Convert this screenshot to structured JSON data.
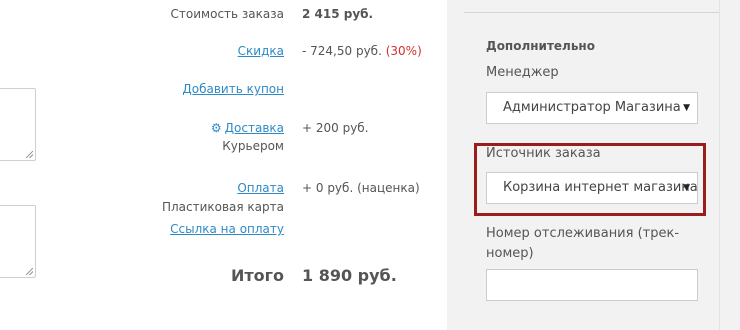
{
  "summary": {
    "order_cost": {
      "label": "Стоимость заказа",
      "value": "2 415 руб."
    },
    "discount": {
      "label": "Скидка",
      "value": "- 724,50 руб.",
      "percent": "(30%)"
    },
    "coupon_link": "Добавить купон",
    "delivery": {
      "label": "Доставка",
      "value": "+ 200 руб.",
      "method": "Курьером",
      "icon": "gear-icon"
    },
    "payment": {
      "label": "Оплата",
      "value": "+ 0 руб. (наценка)",
      "method": "Пластиковая карта",
      "link": "Ссылка на оплату"
    },
    "total": {
      "label": "Итого",
      "value": "1 890 руб."
    }
  },
  "sidebar": {
    "heading": "Дополнительно",
    "manager": {
      "label": "Менеджер",
      "selected": "Администратор Магазина"
    },
    "source": {
      "label": "Источник заказа",
      "selected": "Корзина интернет магазина"
    },
    "tracking": {
      "label_line1": "Номер отслеживания (трек-",
      "label_line2": "номер)",
      "value": ""
    }
  },
  "colors": {
    "link": "#2e8ac7",
    "discount_percent": "#d0312d",
    "highlight_border": "#9b1c1c",
    "sidebar_bg": "#f2f2f2"
  }
}
